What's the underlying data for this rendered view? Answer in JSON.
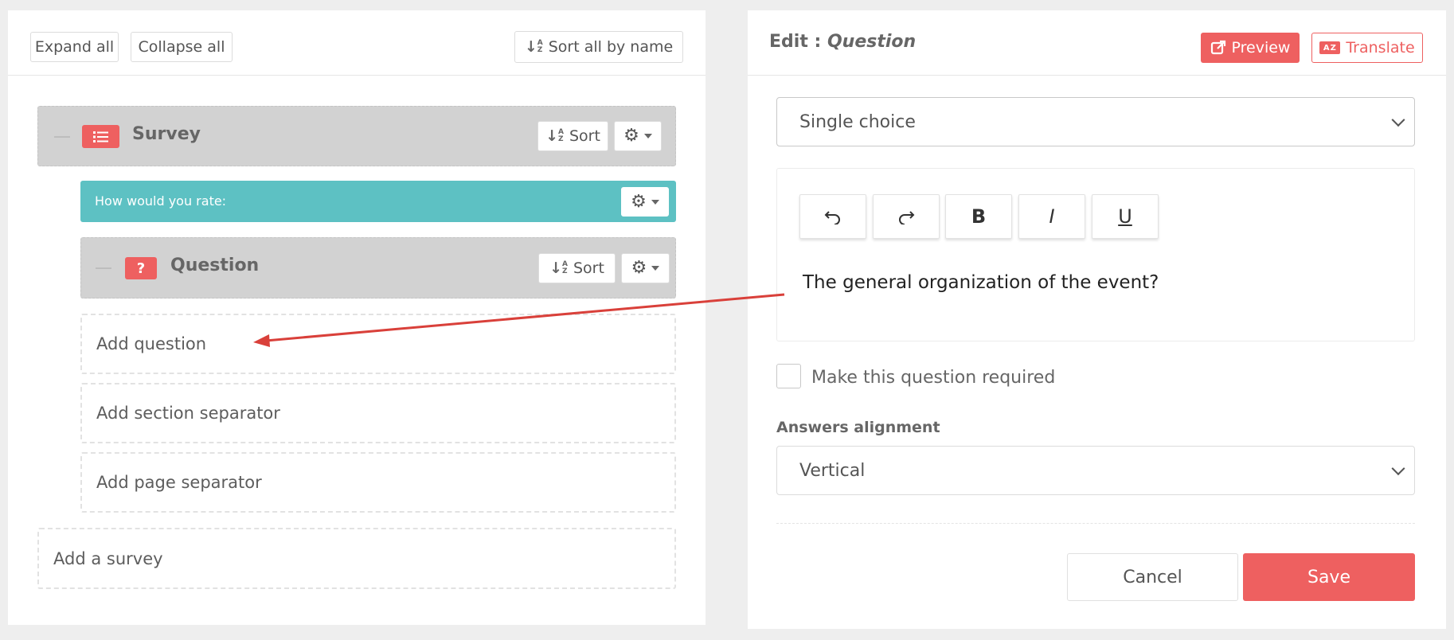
{
  "toolbar": {
    "expand_all": "Expand all",
    "collapse_all": "Collapse all",
    "sort_all": "Sort all by name"
  },
  "tree": {
    "survey": {
      "title": "Survey",
      "sort_label": "Sort"
    },
    "label_item": {
      "text": "How would you rate:"
    },
    "question": {
      "title": "Question",
      "badge": "?",
      "sort_label": "Sort"
    },
    "add_question": "Add question",
    "add_section_separator": "Add section separator",
    "add_page_separator": "Add page separator",
    "add_survey": "Add a survey"
  },
  "editor_panel": {
    "title_prefix": "Edit :",
    "title_item": "Question",
    "preview_label": "Preview",
    "translate_label": "Translate",
    "question_type": "Single choice",
    "toolbar": {
      "undo_icon": "undo-icon",
      "redo_icon": "redo-icon",
      "bold": "B",
      "italic": "I",
      "underline": "U"
    },
    "question_text": "The general organization of the event?",
    "required_label": "Make this question required",
    "required_checked": false,
    "answers_alignment_label": "Answers alignment",
    "answers_alignment_value": "Vertical",
    "cancel_label": "Cancel",
    "save_label": "Save"
  },
  "colors": {
    "accent_red": "#ee6060",
    "teal": "#5dc1c3",
    "grey_block": "#d2d2d2",
    "annotation_arrow": "#d9403a"
  }
}
